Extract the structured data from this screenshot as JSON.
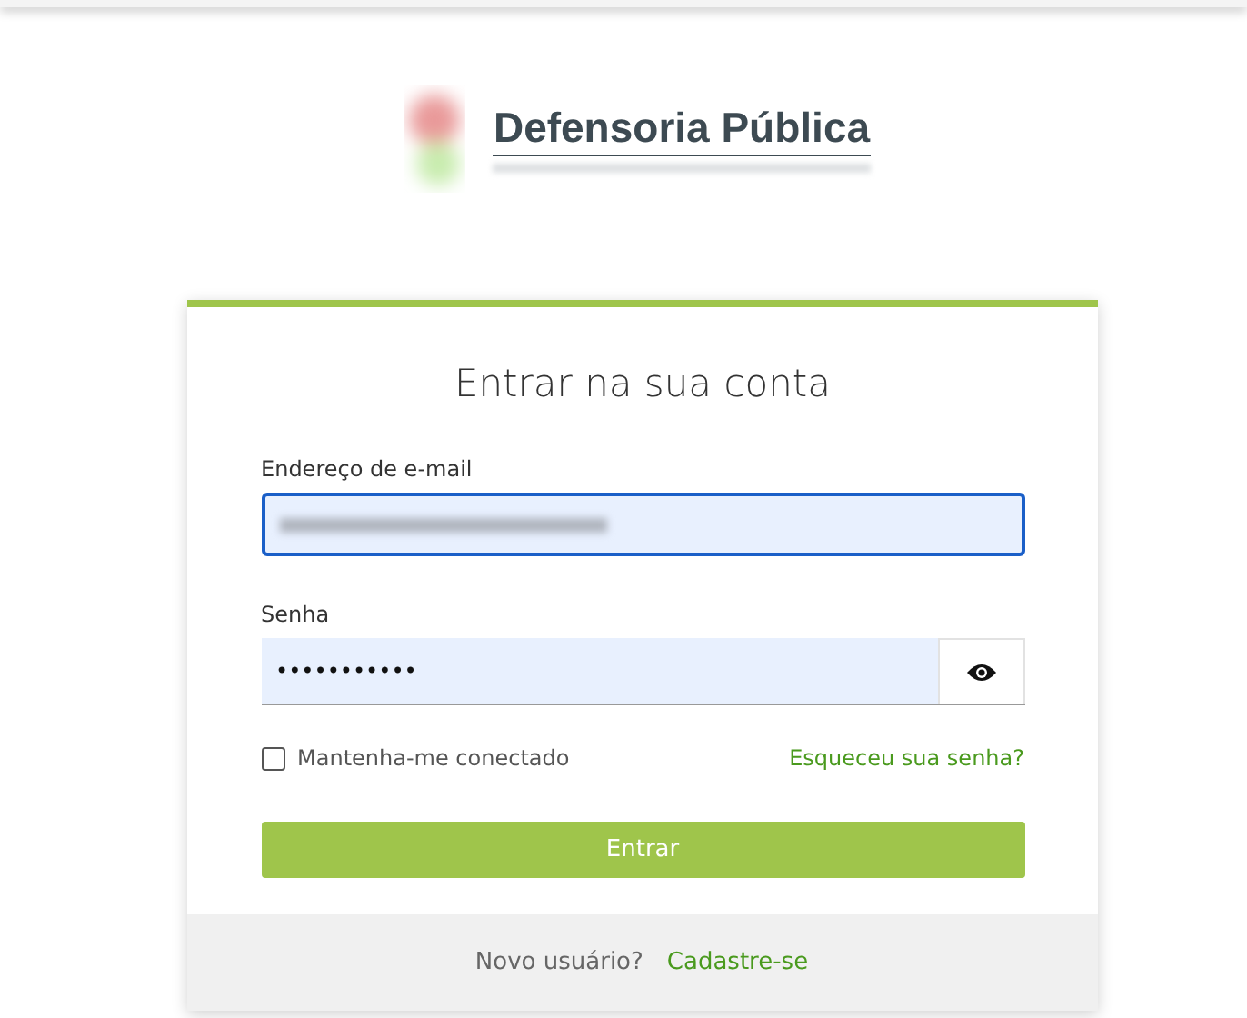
{
  "logo": {
    "name": "Defensoria Pública"
  },
  "card": {
    "title": "Entrar na sua conta"
  },
  "email": {
    "label": "Endereço de e-mail",
    "focused": true
  },
  "password": {
    "label": "Senha",
    "value": "•••••••••••"
  },
  "remember": {
    "label": "Mantenha-me conectado",
    "checked": false
  },
  "forgot_link": "Esqueceu sua senha?",
  "submit_button": "Entrar",
  "footer": {
    "text": "Novo usuário?",
    "link": "Cadastre-se"
  }
}
